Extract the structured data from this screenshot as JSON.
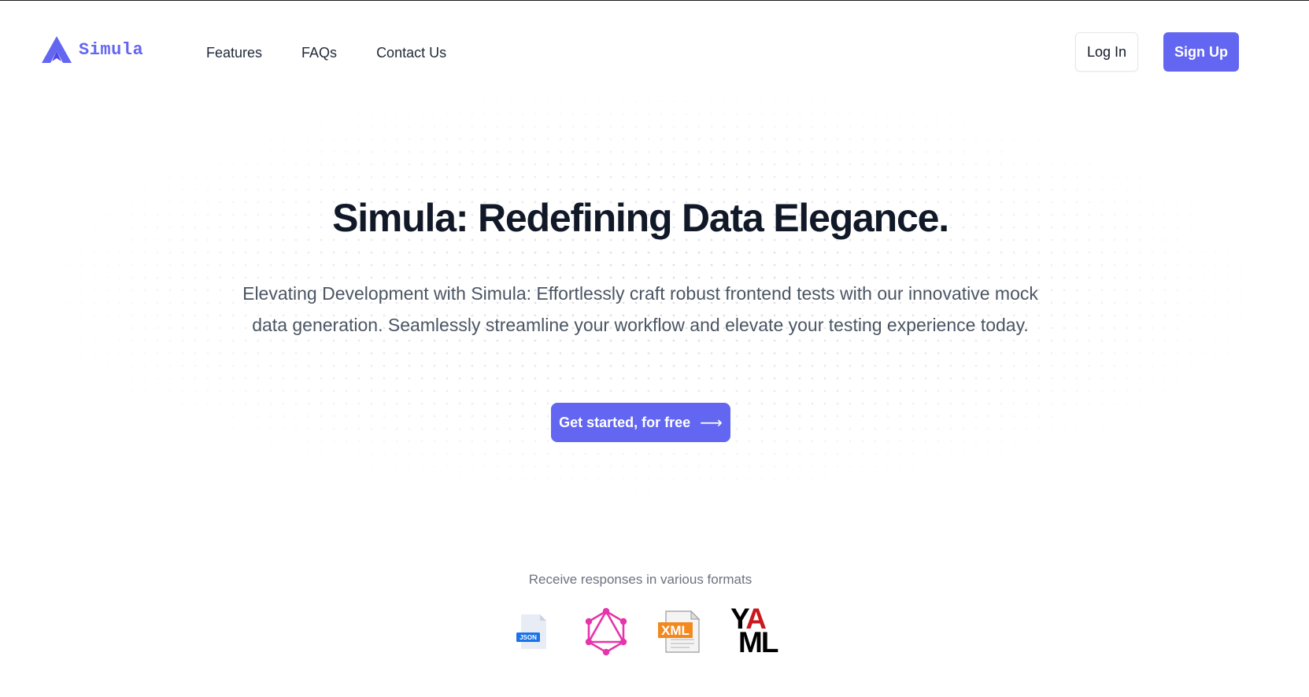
{
  "brand": {
    "name": "Simula",
    "accent": "#6366f1"
  },
  "nav": {
    "items": [
      {
        "label": "Features"
      },
      {
        "label": "FAQs"
      },
      {
        "label": "Contact Us"
      }
    ]
  },
  "auth": {
    "login_label": "Log In",
    "signup_label": "Sign Up"
  },
  "hero": {
    "title": "Simula: Redefining Data Elegance.",
    "subtitle": "Elevating Development with Simula: Effortlessly craft robust frontend tests with our innovative mock data generation. Seamlessly streamline your workflow and elevate your testing experience today.",
    "cta_label": "Get started, for free",
    "cta_icon": "arrow-right-icon"
  },
  "formats": {
    "label": "Receive responses in various formats",
    "items": [
      {
        "name": "json-icon",
        "badge": "JSON"
      },
      {
        "name": "graphql-icon"
      },
      {
        "name": "xml-icon",
        "badge": "XML"
      },
      {
        "name": "yaml-icon",
        "text_top": "YA",
        "text_bottom": "ML"
      }
    ]
  }
}
